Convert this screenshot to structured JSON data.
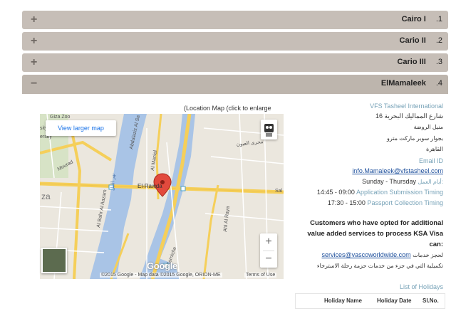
{
  "accordion": [
    {
      "number": ".1",
      "title": "Cairo I",
      "toggle": "+"
    },
    {
      "number": ".2",
      "title": "Cario II",
      "toggle": "+"
    },
    {
      "number": ".3",
      "title": "Cario III",
      "toggle": "+"
    },
    {
      "number": ".4",
      "title": "ElMamaleek",
      "toggle": "−"
    }
  ],
  "map": {
    "caption": "(Location Map (click to enlarge",
    "view_larger": "View larger map",
    "zoom_in": "+",
    "zoom_out": "−",
    "logo": "Google",
    "attribution": "©2015 Google - Map data ©2015 Google, ORION-ME",
    "terms": "Terms of Use",
    "labels": {
      "giza_zoo": "Giza Zoo",
      "mourad": "Mourad",
      "abdulaziz": "Abdulaziz Al Sa",
      "el_rawda": "El-Rawda",
      "al_manial": "Al Manial",
      "al_bahr": "Al Bahr Al Aazam",
      "corniche": "Corniche",
      "al_raya": "Ahl Al Raya",
      "magra": "مجرى العيون",
      "nile": "نهر النيل",
      "sal": "Sal",
      "giza_partial": "za",
      "sity": "sity",
      "ersity": "ersity"
    }
  },
  "info": {
    "company": "VFS Tasheel International",
    "address_1": "16 شارع المماليك البحرية",
    "address_2": "منيل الروضة",
    "address_3": "بجوار سوبر ماركت مترو",
    "address_4": "القاهرة",
    "email_label": "Email ID",
    "email": "info.Mamaleek@vfstasheel.com",
    "workdays_label": "أيام العمل:",
    "workdays": "Sunday - Thursday",
    "app_time": "14:45 - 09:00",
    "app_label": "Application Submission Timing",
    "pass_time": "17:30 - 15:00",
    "pass_label": "Passport Collection Timing",
    "note_1": "Customers who have opted for additional",
    "note_2": "value added services to process KSA Visa",
    "note_3": "can:",
    "services_email": "services@vascoworldwide.com",
    "services_ar": "لحجز خدمات",
    "services_ar_2": "تكميلية التي في جزء من خدمات حزمة رحلة الاسترخاء",
    "holidays_title": "List of Holidays",
    "col_sl": "Sl.No.",
    "col_date": "Holiday Date",
    "col_name": "Holiday Name"
  },
  "colors": {
    "accordion_bg": "#c6beb7",
    "link": "#1d4f9c",
    "muted": "#78a3b8"
  }
}
